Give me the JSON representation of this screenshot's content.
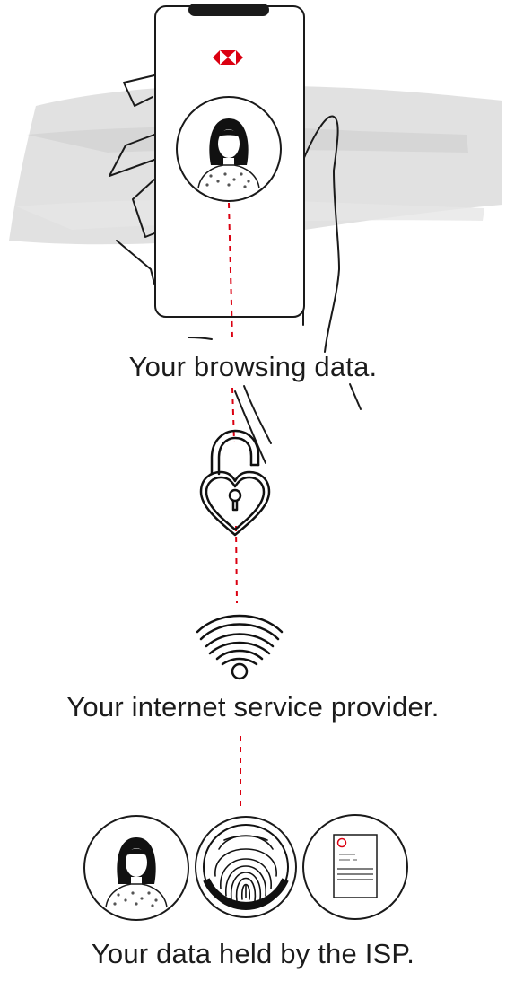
{
  "diagram": {
    "steps": [
      {
        "caption": "Your browsing data."
      },
      {
        "caption": "Your internet service provider."
      },
      {
        "caption": "Your data held by the ISP."
      }
    ],
    "icons": [
      "hsbc-logo-icon",
      "person-avatar-icon",
      "hand-icon",
      "unlocked-heart-padlock-icon",
      "wifi-icon",
      "fingerprint-icon",
      "document-icon"
    ],
    "colors": {
      "accent": "#db0011",
      "line": "#1a1a1a",
      "brush": "#d9d9d9",
      "text": "#1b1b1b"
    }
  }
}
